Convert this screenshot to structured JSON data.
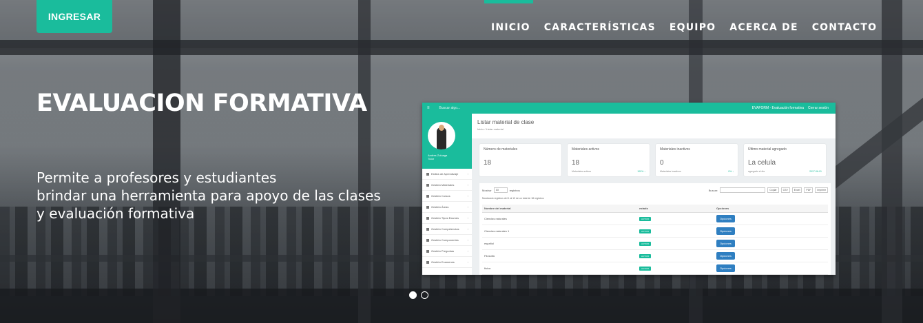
{
  "colors": {
    "accent": "#1abc9c",
    "button_blue": "#2f7fc1",
    "text": "#ffffff"
  },
  "header": {
    "login_button": "INGRESAR",
    "nav": [
      "INICIO",
      "CARACTERÍSTICAS",
      "EQUIPO",
      "ACERCA DE",
      "CONTACTO"
    ],
    "active_nav": "INICIO"
  },
  "hero": {
    "title": "EVALUACION FORMATIVA",
    "description_lines": [
      "Permite a profesores y estudiantes",
      "brindar una herramienta para apoyo de las clases",
      "y evaluación formativa"
    ]
  },
  "slider": {
    "count": 2,
    "active": 0
  },
  "app_preview": {
    "topbar": {
      "search": "Buscar algo...",
      "brand": "EVAFORM - Evaluación formativa",
      "logout": "Cerrar sesión"
    },
    "profile": {
      "name": "Andres Zuluaga",
      "role": "Tutor"
    },
    "sidebar": [
      {
        "icon": "bank-icon",
        "label": "Estilos de Aprendizaje"
      },
      {
        "icon": "book-icon",
        "label": "Gestión Materiales"
      },
      {
        "icon": "pencil-icon",
        "label": "Gestión Cursos"
      },
      {
        "icon": "pencil-icon",
        "label": "Gestión Áreas"
      },
      {
        "icon": "book-icon",
        "label": "Gestión Tipos Exames"
      },
      {
        "icon": "book-icon",
        "label": "Gestión Competencias"
      },
      {
        "icon": "book-icon",
        "label": "Gestión Componentes"
      },
      {
        "icon": "question-icon",
        "label": "Gestión Preguntas"
      },
      {
        "icon": "pencil-icon",
        "label": "Gestión Examenes"
      }
    ],
    "page_title": "Listar material de clase",
    "breadcrumb": [
      "Inicio",
      "Listar material"
    ],
    "cards": [
      {
        "label": "Número de materiales",
        "value": "18",
        "sub": "",
        "pct": ""
      },
      {
        "label": "Materiales activos",
        "value": "18",
        "sub": "Materiales activos",
        "pct": "100% ↑"
      },
      {
        "label": "Materiales inactivos",
        "value": "0",
        "sub": "Materiales inactivos",
        "pct": "0% ↑"
      },
      {
        "label": "Último material agregado",
        "value": "La celula",
        "sub": "agregado el dia",
        "pct": "2017-06-01"
      }
    ],
    "table": {
      "show_label": "Mostrar",
      "page_size": "10",
      "records_label": "registros",
      "search_label": "Buscar:",
      "export_buttons": [
        "Copiar",
        "CSV",
        "Excel",
        "PDF",
        "Imprimir"
      ],
      "info": "Mostrando registros del 1 al 10 de un total de 18 registros",
      "columns": [
        "Nombre del material",
        "estado",
        "Opciones"
      ],
      "rows": [
        {
          "name": "Ciencias naturales",
          "status": "ACTIVO",
          "action": "Opciones"
        },
        {
          "name": "Ciencias naturales 1",
          "status": "ACTIVO",
          "action": "Opciones"
        },
        {
          "name": "español",
          "status": "ACTIVO",
          "action": "Opciones"
        },
        {
          "name": "Filosofia",
          "status": "ACTIVO",
          "action": "Opciones"
        },
        {
          "name": "fisica",
          "status": "ACTIVO",
          "action": "Opciones"
        }
      ]
    }
  }
}
